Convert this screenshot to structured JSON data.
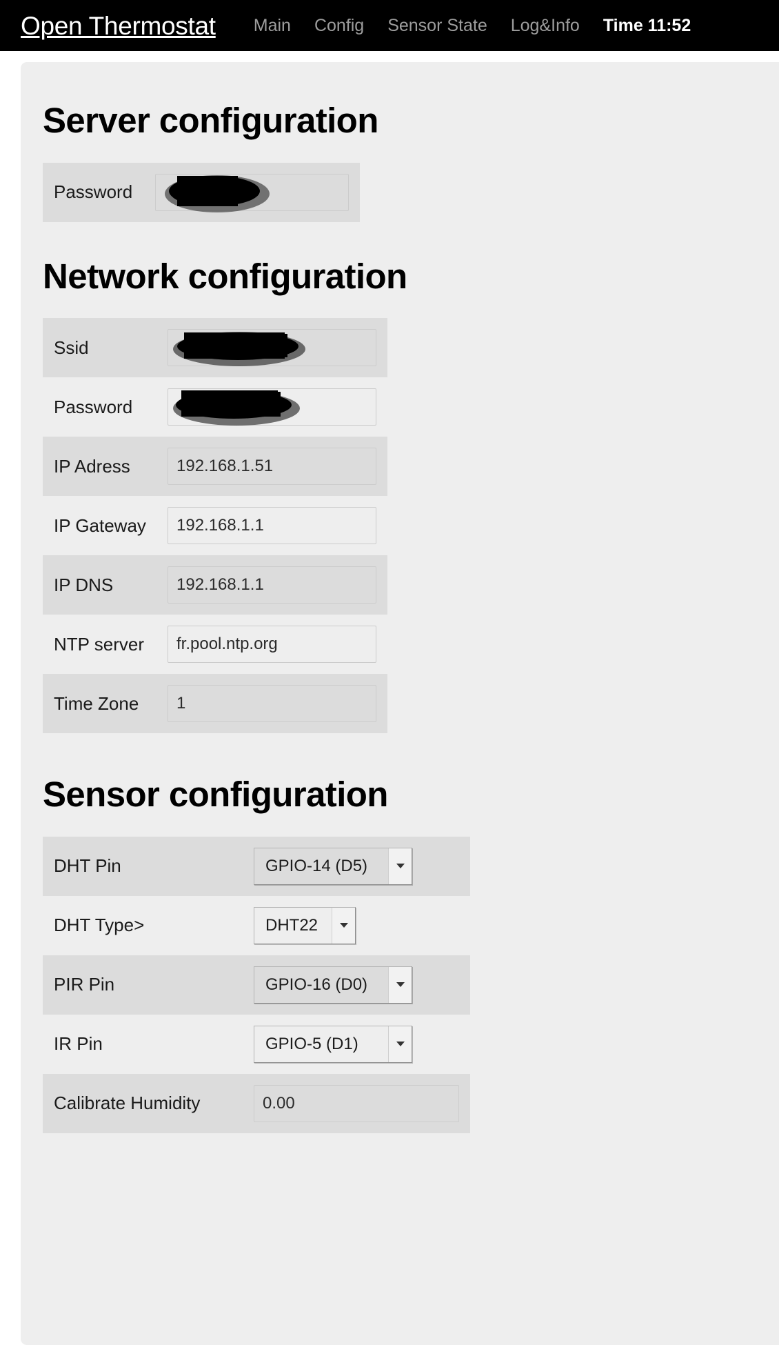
{
  "navbar": {
    "brand": "Open Thermostat",
    "links": [
      {
        "label": "Main",
        "active": false
      },
      {
        "label": "Config",
        "active": false
      },
      {
        "label": "Sensor State",
        "active": false
      },
      {
        "label": "Log&Info",
        "active": false
      },
      {
        "label": "Time 11:52",
        "active": true
      }
    ]
  },
  "sections": {
    "server": {
      "title": "Server configuration",
      "rows": [
        {
          "label": "Password",
          "value": "",
          "redacted": true,
          "type": "password"
        }
      ]
    },
    "network": {
      "title": "Network configuration",
      "rows": [
        {
          "label": "Ssid",
          "value": "",
          "redacted": true,
          "type": "text"
        },
        {
          "label": "Password",
          "value": "",
          "redacted": true,
          "type": "password"
        },
        {
          "label": "IP Adress",
          "value": "192.168.1.51",
          "redacted": false,
          "type": "text"
        },
        {
          "label": "IP Gateway",
          "value": "192.168.1.1",
          "redacted": false,
          "type": "text"
        },
        {
          "label": "IP DNS",
          "value": "192.168.1.1",
          "redacted": false,
          "type": "text"
        },
        {
          "label": "NTP server",
          "value": "fr.pool.ntp.org",
          "redacted": false,
          "type": "text"
        },
        {
          "label": "Time Zone",
          "value": "1",
          "redacted": false,
          "type": "text"
        }
      ]
    },
    "sensor": {
      "title": "Sensor configuration",
      "rows": [
        {
          "label": "DHT Pin",
          "value": "GPIO-14 (D5)",
          "type": "select",
          "width": "wide"
        },
        {
          "label": "DHT Type>",
          "value": "DHT22",
          "type": "select",
          "width": "narrow"
        },
        {
          "label": "PIR Pin",
          "value": "GPIO-16 (D0)",
          "type": "select",
          "width": "wide"
        },
        {
          "label": "IR Pin",
          "value": "GPIO-5 (D1)",
          "type": "select",
          "width": "wide"
        },
        {
          "label": "Calibrate Humidity",
          "value": "0.00",
          "type": "text",
          "redacted": false
        }
      ]
    }
  },
  "colors": {
    "navbar_bg": "#000000",
    "nav_link": "#9d9d9d",
    "nav_link_active": "#ffffff",
    "jumbotron_bg": "#eeeeee",
    "row_stripe": "#dcdcdc",
    "text": "#1a1a1a"
  }
}
